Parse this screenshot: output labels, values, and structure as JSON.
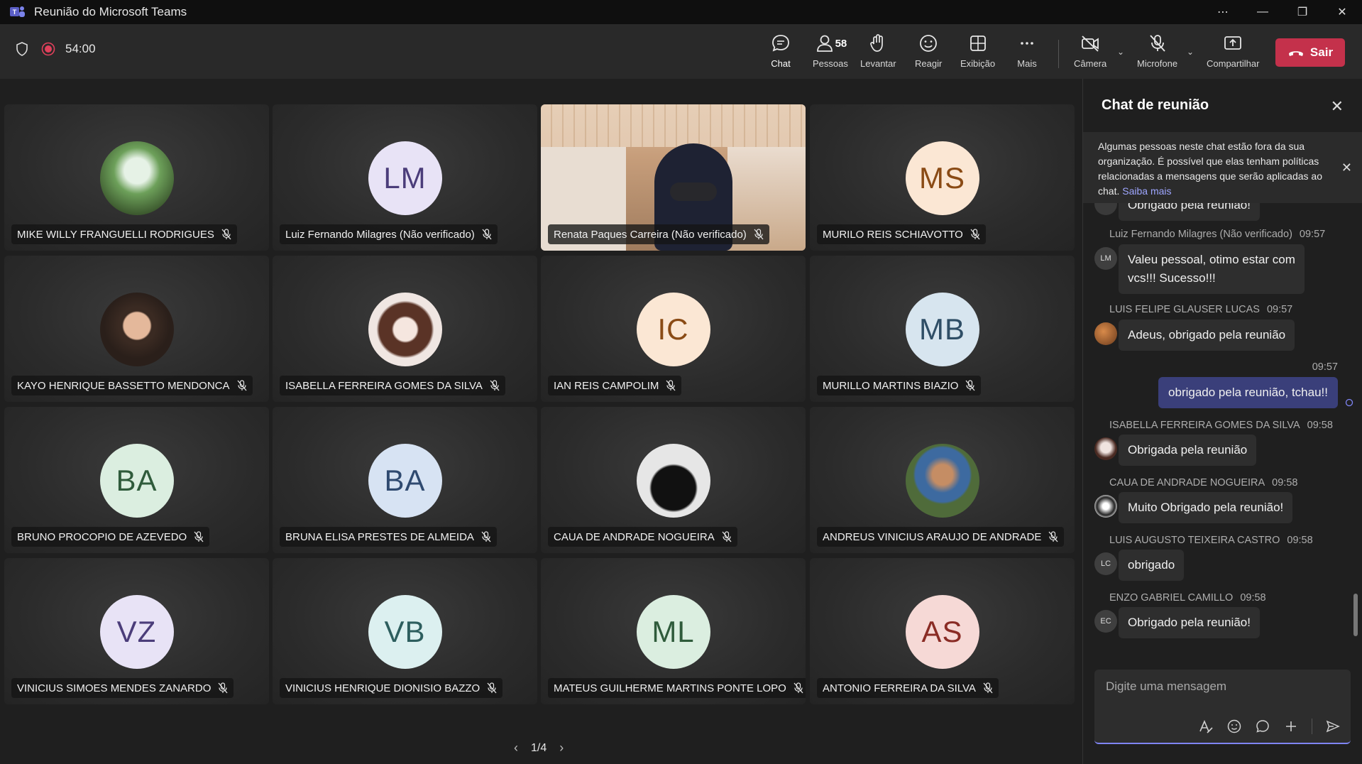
{
  "window": {
    "title": "Reunião do Microsoft Teams"
  },
  "toolbar": {
    "timer": "54:00",
    "chat_label": "Chat",
    "people_label": "Pessoas",
    "people_count": "58",
    "raise_label": "Levantar",
    "react_label": "Reagir",
    "view_label": "Exibição",
    "more_label": "Mais",
    "camera_label": "Câmera",
    "mic_label": "Microfone",
    "share_label": "Compartilhar",
    "leave_label": "Sair"
  },
  "participants": [
    {
      "name": "MIKE WILLY FRANGUELLI RODRIGUES",
      "initials": "",
      "avatar_type": "photo-anime-green",
      "bg": "#5b7a4a",
      "fg": "#fff"
    },
    {
      "name": "Luiz Fernando Milagres (Não verificado)",
      "initials": "LM",
      "avatar_type": "initials",
      "bg": "#e8e3f6",
      "fg": "#4b3d7a"
    },
    {
      "name": "Renata Paques Carreira (Não verificado)",
      "initials": "",
      "avatar_type": "video",
      "bg": "#b48e6d",
      "fg": "#fff"
    },
    {
      "name": "MURILO REIS SCHIAVOTTO",
      "initials": "MS",
      "avatar_type": "initials",
      "bg": "#fbe7d4",
      "fg": "#8a4b15"
    },
    {
      "name": "KAYO HENRIQUE BASSETTO MENDONCA",
      "initials": "",
      "avatar_type": "photo-person",
      "bg": "#3b2f2a",
      "fg": "#fff"
    },
    {
      "name": "ISABELLA FERREIRA GOMES DA SILVA",
      "initials": "",
      "avatar_type": "photo-anime-girl",
      "bg": "#efe4e0",
      "fg": "#3b2a26"
    },
    {
      "name": "IAN REIS CAMPOLIM",
      "initials": "IC",
      "avatar_type": "initials",
      "bg": "#fbe7d4",
      "fg": "#8a4b15"
    },
    {
      "name": "MURILLO MARTINS BIAZIO",
      "initials": "MB",
      "avatar_type": "initials",
      "bg": "#d7e5ef",
      "fg": "#2f4e66"
    },
    {
      "name": "BRUNO PROCOPIO DE AZEVEDO",
      "initials": "BA",
      "avatar_type": "initials",
      "bg": "#dbeee0",
      "fg": "#2f5b3b"
    },
    {
      "name": "BRUNA ELISA PRESTES DE ALMEIDA",
      "initials": "BA",
      "avatar_type": "initials",
      "bg": "#d7e3f3",
      "fg": "#2f4a70"
    },
    {
      "name": "CAUA DE ANDRADE NOGUEIRA",
      "initials": "",
      "avatar_type": "photo-jersey",
      "bg": "#d9d9d9",
      "fg": "#111"
    },
    {
      "name": "ANDREUS VINICIUS ARAUJO DE ANDRADE",
      "initials": "",
      "avatar_type": "photo-person-outdoor",
      "bg": "#4f6b3a",
      "fg": "#fff"
    },
    {
      "name": "VINICIUS SIMOES MENDES ZANARDO",
      "initials": "VZ",
      "avatar_type": "initials",
      "bg": "#e8e3f6",
      "fg": "#4b3d7a"
    },
    {
      "name": "VINICIUS HENRIQUE DIONISIO BAZZO",
      "initials": "VB",
      "avatar_type": "initials",
      "bg": "#dcf0f0",
      "fg": "#2d5e5e"
    },
    {
      "name": "MATEUS GUILHERME MARTINS PONTE LOPO",
      "initials": "ML",
      "avatar_type": "initials",
      "bg": "#dbeee0",
      "fg": "#2f5b3b"
    },
    {
      "name": "ANTONIO FERREIRA DA SILVA",
      "initials": "AS",
      "avatar_type": "initials",
      "bg": "#f6d9d6",
      "fg": "#8a2c25"
    }
  ],
  "pager": {
    "label": "1/4"
  },
  "chat": {
    "title": "Chat de reunião",
    "notice_text": "Algumas pessoas neste chat estão fora da sua organização. É possível que elas tenham políticas relacionadas a mensagens que serão aplicadas ao chat.",
    "notice_link": "Saiba mais",
    "partial_message": "Obrigado pela reunião!",
    "messages": [
      {
        "author": "Luiz Fernando Milagres (Não verificado)",
        "time": "09:57",
        "initials": "LM",
        "text_line1": "Valeu pessoal, otimo estar com",
        "text_line2": "vcs!!! Sucesso!!!"
      },
      {
        "author": "LUIS FELIPE GLAUSER LUCAS",
        "time": "09:57",
        "initials": "",
        "text": "Adeus, obrigado pela reunião"
      },
      {
        "author": "",
        "time": "09:57",
        "initials": "",
        "text": "obrigado pela reunião, tchau!!",
        "mine": true
      },
      {
        "author": "ISABELLA FERREIRA GOMES DA SILVA",
        "time": "09:58",
        "initials": "",
        "text": "Obrigada pela reunião"
      },
      {
        "author": "CAUA DE ANDRADE NOGUEIRA",
        "time": "09:58",
        "initials": "",
        "text": "Muito Obrigado pela reunião!"
      },
      {
        "author": "LUIS AUGUSTO TEIXEIRA CASTRO",
        "time": "09:58",
        "initials": "LC",
        "text": "obrigado"
      },
      {
        "author": "ENZO GABRIEL CAMILLO",
        "time": "09:58",
        "initials": "EC",
        "text": "Obrigado pela reunião!"
      }
    ],
    "compose_placeholder": "Digite uma mensagem"
  },
  "colors": {
    "accent": "#7f85f5",
    "leave": "#c4314b",
    "my_bubble": "#3a3f7a"
  }
}
